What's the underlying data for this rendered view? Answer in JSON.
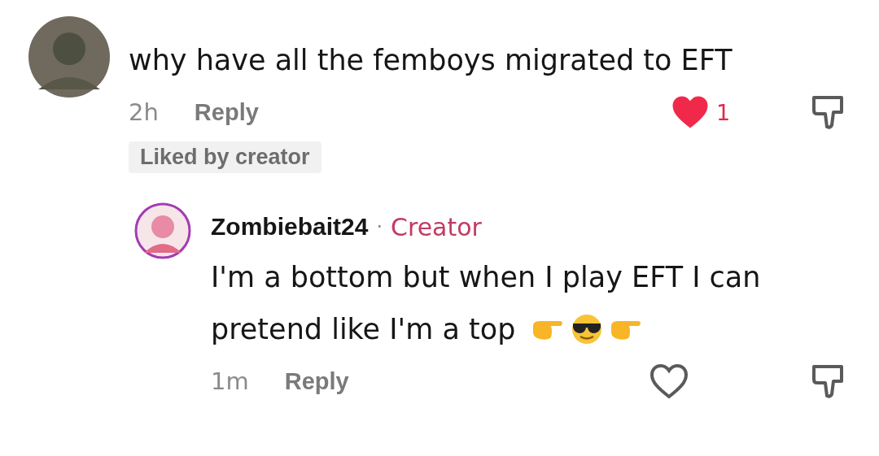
{
  "comment": {
    "text": "why have all the femboys migrated to EFT",
    "time": "2h",
    "reply_label": "Reply",
    "liked": true,
    "like_count": "1",
    "badge": "Liked by creator"
  },
  "reply": {
    "author": "Zombiebait24",
    "separator": "·",
    "role": "Creator",
    "lines": [
      "I'm a bottom but when I play EFT I can",
      "pretend like I'm a top"
    ],
    "emoji": [
      {
        "kind": "point"
      },
      {
        "kind": "cool"
      },
      {
        "kind": "point"
      }
    ],
    "time": "1m",
    "reply_label": "Reply",
    "liked": false
  }
}
